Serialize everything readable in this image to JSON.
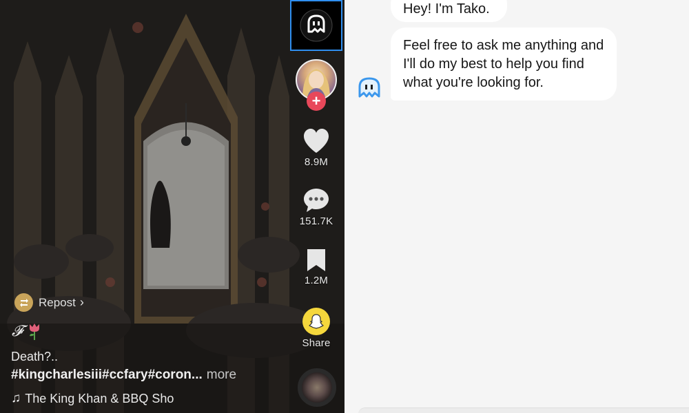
{
  "video": {
    "actions": {
      "likes": "8.9M",
      "comments": "151.7K",
      "saves": "1.2M",
      "share_label": "Share"
    },
    "repost": {
      "label": "Repost",
      "chevron": "›"
    },
    "caption": {
      "script_letter": "𝓕",
      "title": "Death?..",
      "hashtags": "#kingcharlesiii#ccfary#coron...",
      "more": "more"
    },
    "sound": {
      "note": "♫",
      "title": "The King Khan & BBQ Sho"
    },
    "follow_symbol": "+"
  },
  "chat": {
    "messages": [
      {
        "sender": "tako",
        "text": "Hey! I'm Tako."
      },
      {
        "sender": "tako",
        "text": "Feel free to ask me anything and I'll do my best to help you find what you're looking for."
      }
    ]
  },
  "colors": {
    "accent_blue": "#2f8ff0",
    "follow_red": "#e8485a",
    "snap_yellow": "#f5d73c",
    "chat_bg": "#f5f5f5"
  },
  "icons": [
    "tako-icon",
    "heart-icon",
    "comment-icon",
    "bookmark-icon",
    "snapchat-icon",
    "repost-icon",
    "music-note-icon",
    "tulip-icon"
  ]
}
